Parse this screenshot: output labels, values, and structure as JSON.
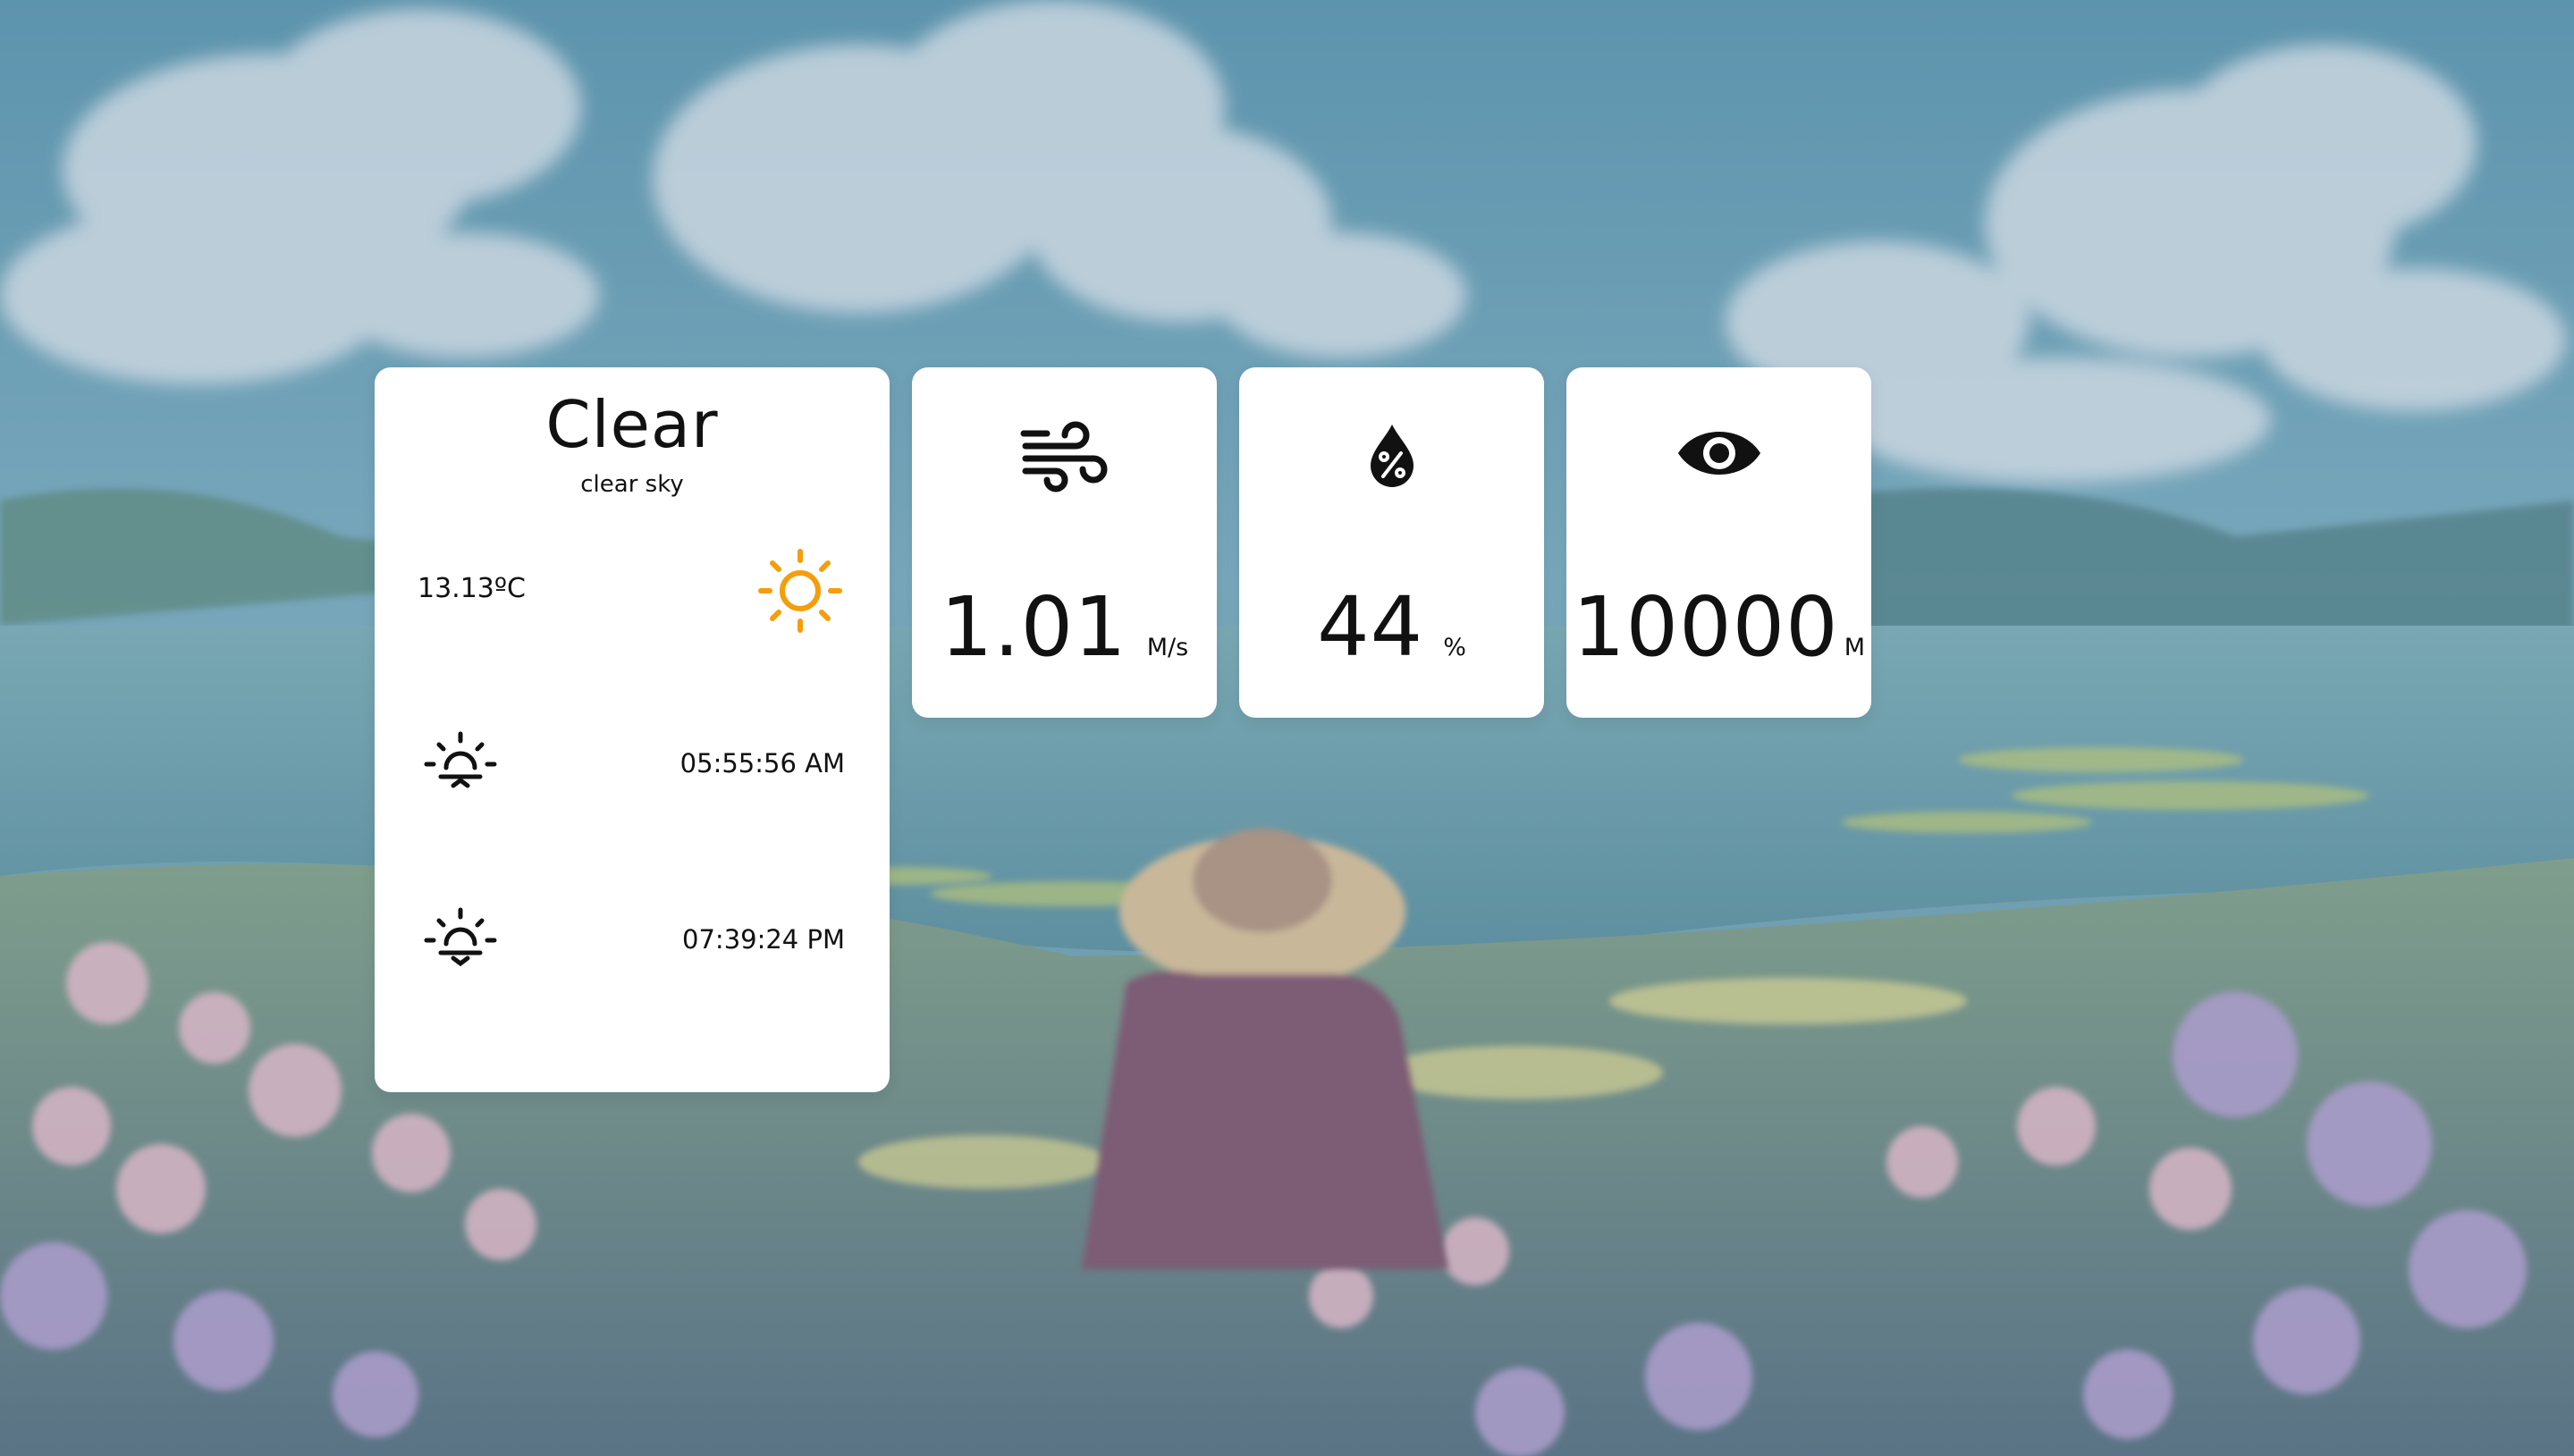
{
  "weather": {
    "condition": "Clear",
    "description": "clear sky",
    "temperature": "13.13ºC",
    "sunrise": "05:55:56 AM",
    "sunset": "07:39:24 PM",
    "condition_icon": "sun-icon",
    "sunrise_icon": "sunrise-icon",
    "sunset_icon": "sunset-icon",
    "sun_color": "#f59e0b"
  },
  "stats": {
    "wind": {
      "icon": "wind-icon",
      "value": "1.01",
      "unit": "M/s"
    },
    "humidity": {
      "icon": "humidity-drop-icon",
      "value": "44",
      "unit": "%"
    },
    "visibility": {
      "icon": "eye-icon",
      "value": "10000",
      "unit": "M"
    }
  }
}
